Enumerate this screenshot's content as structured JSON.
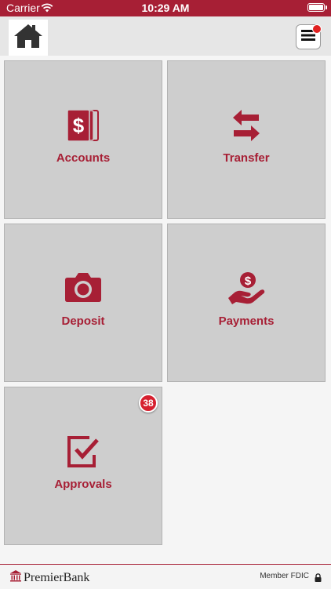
{
  "status_bar": {
    "carrier": "Carrier",
    "time": "10:29 AM"
  },
  "colors": {
    "brand": "#a71f35",
    "tile_bg": "#cecece",
    "badge": "#d6202f"
  },
  "header": {
    "home_icon": "home-icon",
    "menu_icon": "hamburger-menu-icon",
    "menu_has_notification": true
  },
  "tiles": [
    {
      "label": "Accounts",
      "icon": "dollar-cards-icon"
    },
    {
      "label": "Transfer",
      "icon": "transfer-arrows-icon"
    },
    {
      "label": "Deposit",
      "icon": "camera-icon"
    },
    {
      "label": "Payments",
      "icon": "hand-coin-icon"
    },
    {
      "label": "Approvals",
      "icon": "checkbox-icon",
      "badge": "38"
    }
  ],
  "footer": {
    "bank_name": "PremierBank",
    "member_text": "Member FDIC"
  }
}
